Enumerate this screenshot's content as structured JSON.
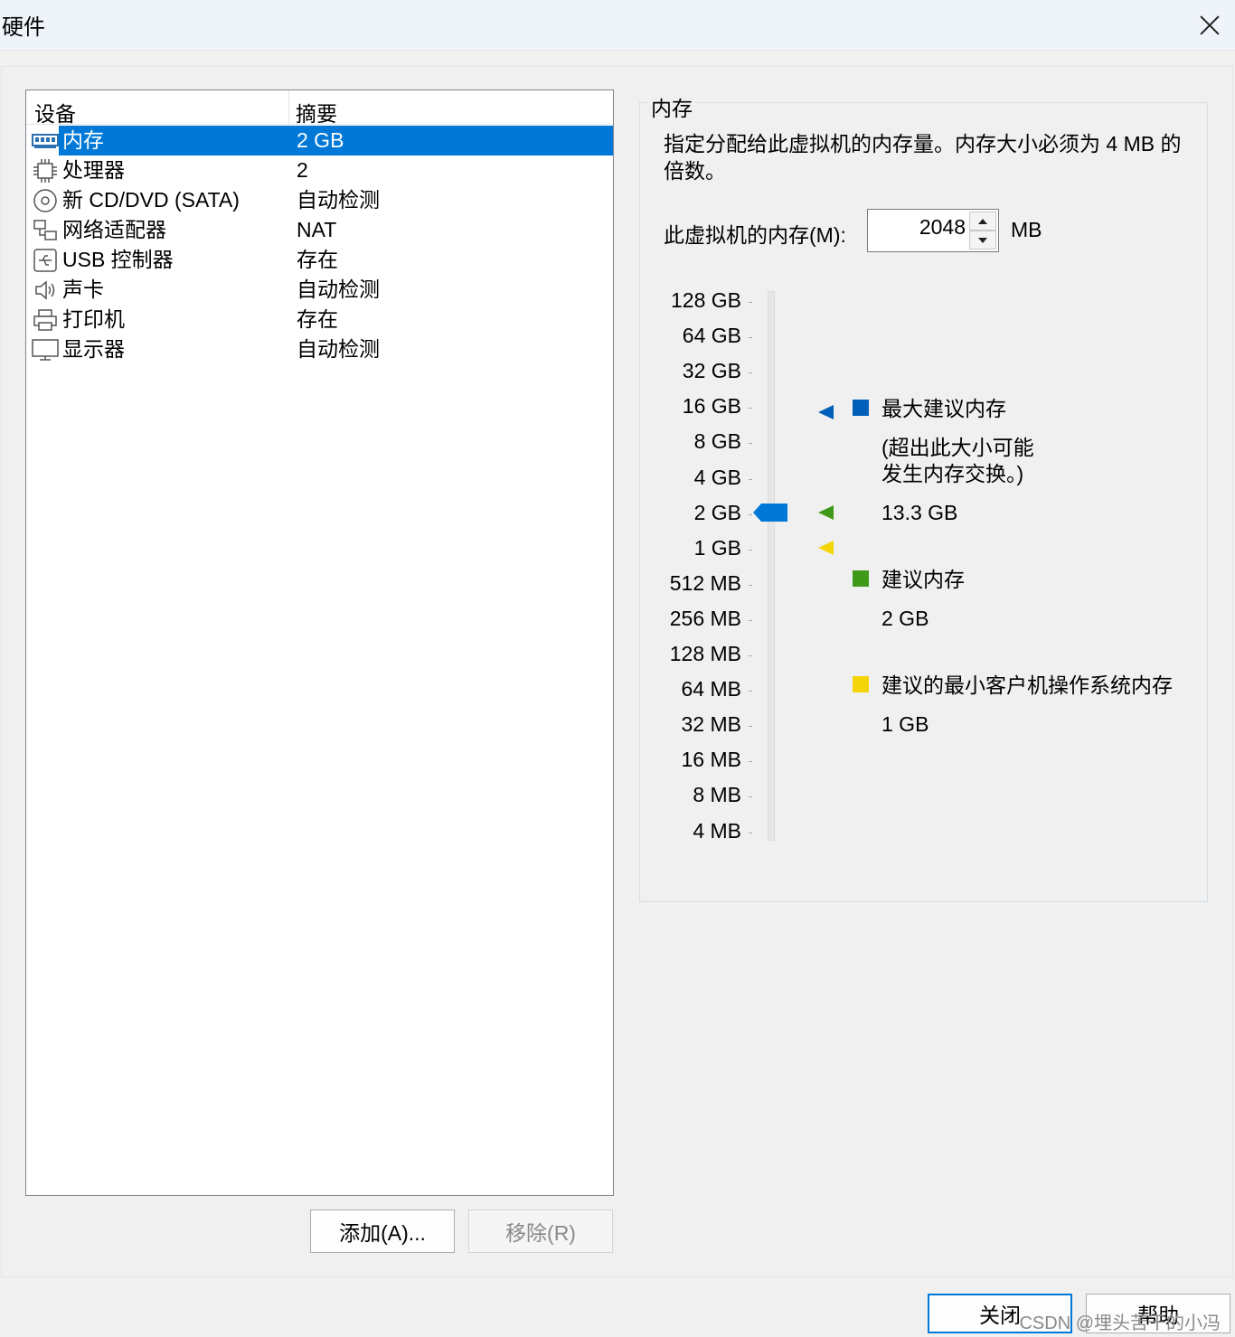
{
  "window": {
    "title": "硬件"
  },
  "device_list": {
    "headers": {
      "device": "设备",
      "summary": "摘要"
    },
    "rows": [
      {
        "name": "内存",
        "summary": "2 GB",
        "icon": "memory-icon"
      },
      {
        "name": "处理器",
        "summary": "2",
        "icon": "processor-icon"
      },
      {
        "name": "新 CD/DVD (SATA)",
        "summary": "自动检测",
        "icon": "cd-dvd-icon"
      },
      {
        "name": "网络适配器",
        "summary": "NAT",
        "icon": "network-adapter-icon"
      },
      {
        "name": "USB 控制器",
        "summary": "存在",
        "icon": "usb-icon"
      },
      {
        "name": "声卡",
        "summary": "自动检测",
        "icon": "speaker-icon"
      },
      {
        "name": "打印机",
        "summary": "存在",
        "icon": "printer-icon"
      },
      {
        "name": "显示器",
        "summary": "自动检测",
        "icon": "monitor-icon"
      }
    ],
    "selected_index": 0
  },
  "buttons": {
    "add": "添加(A)...",
    "remove": "移除(R)",
    "close": "关闭",
    "help": "帮助"
  },
  "memory_panel": {
    "title": "内存",
    "description": "指定分配给此虚拟机的内存量。内存大小必须为 4 MB 的倍数。",
    "input_label": "此虚拟机的内存(M):",
    "input_value": "2048",
    "unit": "MB",
    "scale": [
      "128 GB",
      "64 GB",
      "32 GB",
      "16 GB",
      "8 GB",
      "4 GB",
      "2 GB",
      "1 GB",
      "512 MB",
      "256 MB",
      "128 MB",
      "64 MB",
      "32 MB",
      "16 MB",
      "8 MB",
      "4 MB"
    ],
    "slider_value": "2 GB",
    "legend": {
      "max": {
        "label": "最大建议内存",
        "note_line1": "(超出此大小可能",
        "note_line2": "发生内存交换。)",
        "value": "13.3 GB",
        "color": "#005fb8"
      },
      "recommended": {
        "label": "建议内存",
        "value": "2 GB",
        "color": "#3f9a1a"
      },
      "min_guest": {
        "label": "建议的最小客户机操作系统内存",
        "value": "1 GB",
        "color": "#f4d50a"
      }
    }
  },
  "watermark": "CSDN @埋头苦干的小冯"
}
